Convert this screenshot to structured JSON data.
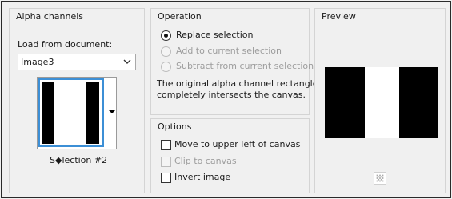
{
  "alpha": {
    "title": "Alpha channels",
    "load_label": "Load from document:",
    "document": "Image3",
    "selection_name": "S◆lection #2"
  },
  "operation": {
    "title": "Operation",
    "options": [
      {
        "label": "Replace selection",
        "selected": true,
        "enabled": true
      },
      {
        "label": "Add to current selection",
        "selected": false,
        "enabled": false
      },
      {
        "label": "Subtract from current selection",
        "selected": false,
        "enabled": false
      }
    ],
    "message_line1": "The original alpha channel rectangle",
    "message_line2": "completely intersects the canvas."
  },
  "options": {
    "title": "Options",
    "items": [
      {
        "label": "Move to upper left of canvas",
        "checked": false,
        "enabled": true
      },
      {
        "label": "Clip to canvas",
        "checked": false,
        "enabled": false
      },
      {
        "label": "Invert image",
        "checked": false,
        "enabled": true
      }
    ]
  },
  "preview": {
    "title": "Preview"
  },
  "icons": {
    "dropdown": "chevron-down-icon",
    "thumb_dropdown": "triangle-down-icon",
    "zoom": "checker-icon"
  }
}
